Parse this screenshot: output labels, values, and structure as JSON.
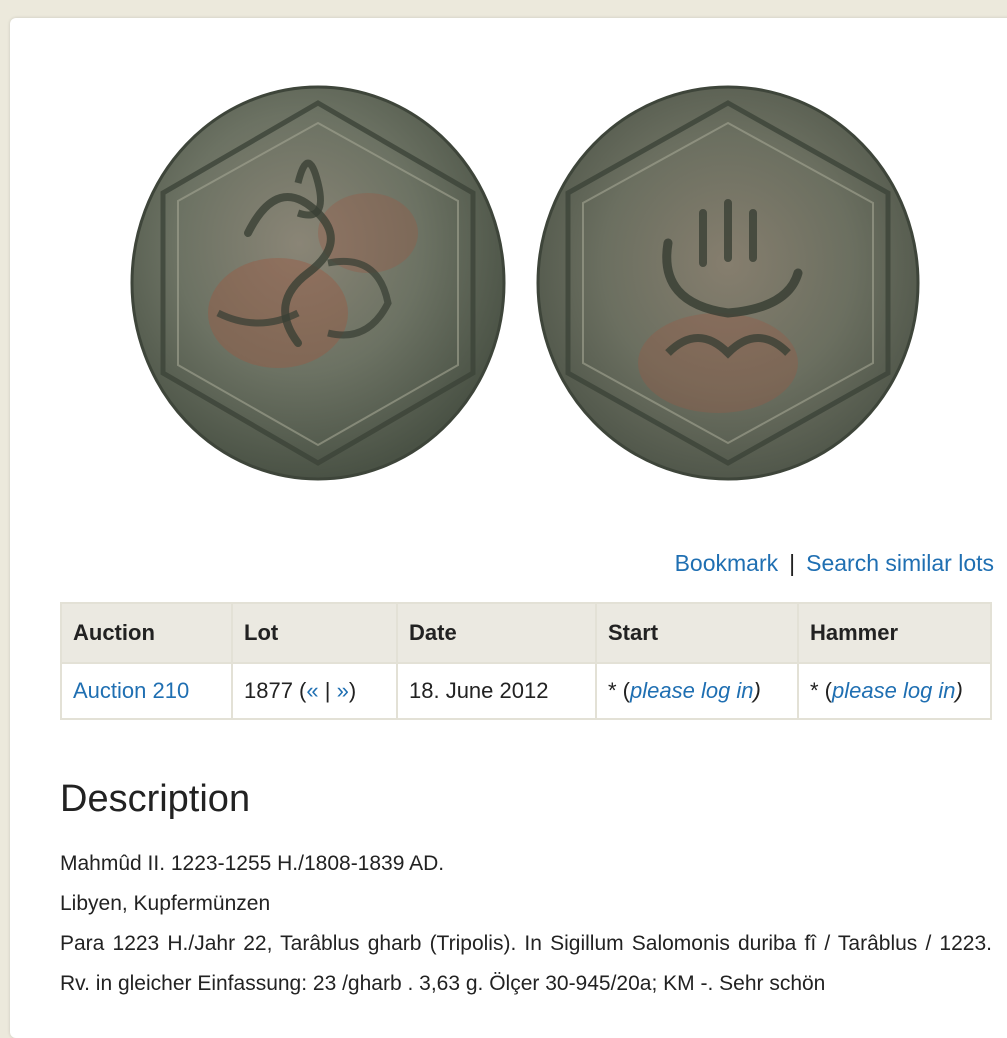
{
  "actions": {
    "bookmark": "Bookmark",
    "separator": "|",
    "search_similar": "Search similar lots"
  },
  "table": {
    "headers": [
      "Auction",
      "Lot",
      "Date",
      "Start",
      "Hammer"
    ],
    "row": {
      "auction": "Auction 210",
      "lot_number": "1877 (",
      "lot_prev": "«",
      "lot_sep": " | ",
      "lot_next": "»",
      "lot_close": ")",
      "date": "18. June 2012",
      "start_prefix": "* (",
      "start_link": "please log in",
      "start_suffix": ")",
      "hammer_prefix": "* (",
      "hammer_link": "please log in",
      "hammer_suffix": ")"
    }
  },
  "description": {
    "heading": "Description",
    "line1": "Mahmûd II. 1223-1255 H./1808-1839 AD.",
    "line2": "Libyen, Kupfermünzen",
    "line3": "Para 1223 H./Jahr 22, Tarâblus gharb (Tripolis). In Sigillum Salomonis duriba fî / Tarâblus / 1223. Rv. in gleicher Einfassung: 23 /gharb . 3,63 g. Ölçer 30-945/20a; KM -. Sehr schön"
  },
  "colors": {
    "link": "#1f6fb2",
    "page_bg": "#ece9dc",
    "header_bg": "#ebe9e1",
    "coin_dark": "#4f5a4c",
    "coin_mid": "#7d8674",
    "coin_rust": "#9a5a45"
  }
}
